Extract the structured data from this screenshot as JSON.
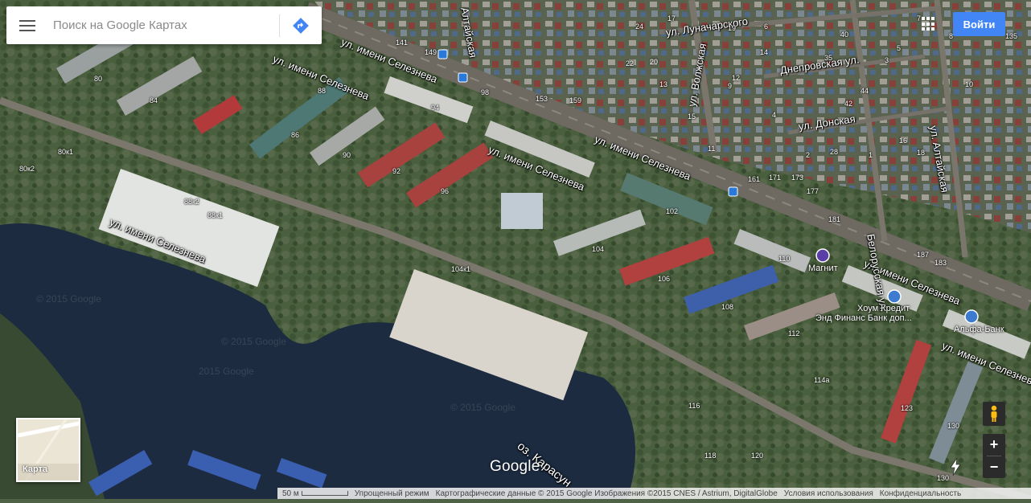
{
  "search": {
    "placeholder": "Поиск на Google Картах"
  },
  "header": {
    "signin_label": "Войти"
  },
  "layer_switcher": {
    "label": "Карта"
  },
  "zoom": {
    "in_label": "+",
    "out_label": "−"
  },
  "logo": "Google",
  "footer": {
    "scale": "50 м",
    "lite_mode": "Упрощенный режим",
    "attribution": "Картографические данные © 2015 Google Изображения ©2015 CNES / Astrium, DigitalGlobe",
    "terms": "Условия использования",
    "privacy": "Конфиденциальность"
  },
  "watermarks": [
    "© 2015 Google",
    "© 2015 Google",
    "2015 Google",
    "© 2015 Google"
  ],
  "streets": [
    "ул. имени Селезнева",
    "ул. имени Селезнева",
    "ул. имени Селезнева",
    "ул. имени Селезнева",
    "ул. имени Селезнева",
    "ул. имени Селезнева",
    "ул. имени Селезнева",
    "ул. Луначарского",
    "ул. Волжская",
    "Днепровская ул.",
    "ул. Донская",
    "Белорусская ул.",
    "ул. Алтайская",
    "Алтайская",
    "оз. Карасун"
  ],
  "pois": [
    "Магнит",
    "Хоум Кредит",
    "Энд Финанс Банк доп...",
    "Альфа-Банк"
  ],
  "building_numbers": [
    "80",
    "84",
    "86",
    "88",
    "90",
    "92",
    "94",
    "96",
    "98",
    "80к1",
    "80к2",
    "88к1",
    "88к2",
    "104к1",
    "102",
    "104",
    "106",
    "108",
    "110",
    "112",
    "114а",
    "116",
    "118",
    "120",
    "123",
    "130",
    "141",
    "149",
    "153",
    "159",
    "161",
    "171",
    "173",
    "177",
    "181",
    "183",
    "187",
    "35",
    "40",
    "42",
    "44",
    "17",
    "19",
    "12",
    "14",
    "16",
    "18",
    "20",
    "22",
    "24",
    "28",
    "13",
    "15",
    "11",
    "9",
    "6",
    "4",
    "2",
    "1",
    "3",
    "5",
    "7",
    "8",
    "10",
    "130",
    "135"
  ],
  "colors": {
    "accent": "#4285f4",
    "water": "#1b2a3f"
  }
}
